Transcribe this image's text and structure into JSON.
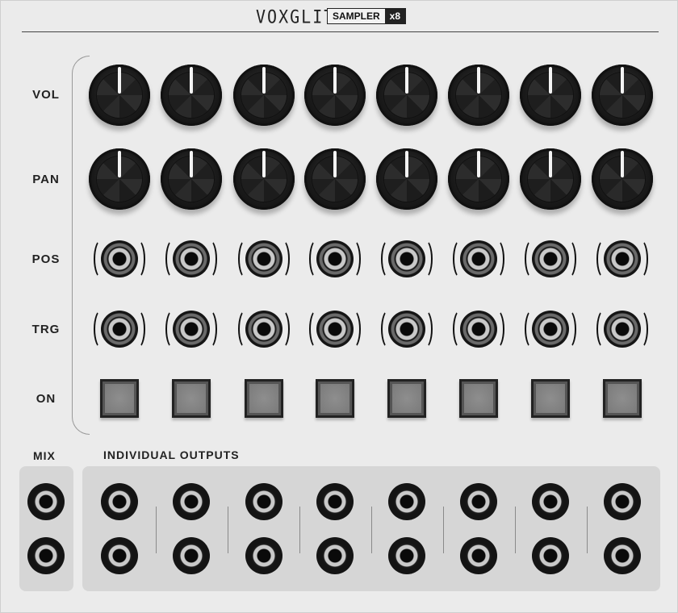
{
  "header": {
    "brand": "VOXGLITCH",
    "module_name": "SAMPLER",
    "module_count": "x8"
  },
  "rows": {
    "vol": "VOL",
    "pan": "PAN",
    "pos": "POS",
    "trg": "TRG",
    "on": "ON"
  },
  "sections": {
    "mix": "MIX",
    "individual_outputs": "INDIVIDUAL OUTPUTS"
  },
  "controls": {
    "channel_count": 8,
    "vol_knob_icon": "knob-icon",
    "pan_knob_icon": "knob-icon",
    "pos_input_icon": "cv-input-jack-icon",
    "trg_input_icon": "trigger-input-jack-icon",
    "on_button_icon": "square-button-icon",
    "output_icon": "output-jack-icon"
  },
  "colors": {
    "panel": "#ebebeb",
    "knob": "#1a1a1a",
    "pointer": "#f4f4f4",
    "output_area": "#d6d6d6"
  }
}
